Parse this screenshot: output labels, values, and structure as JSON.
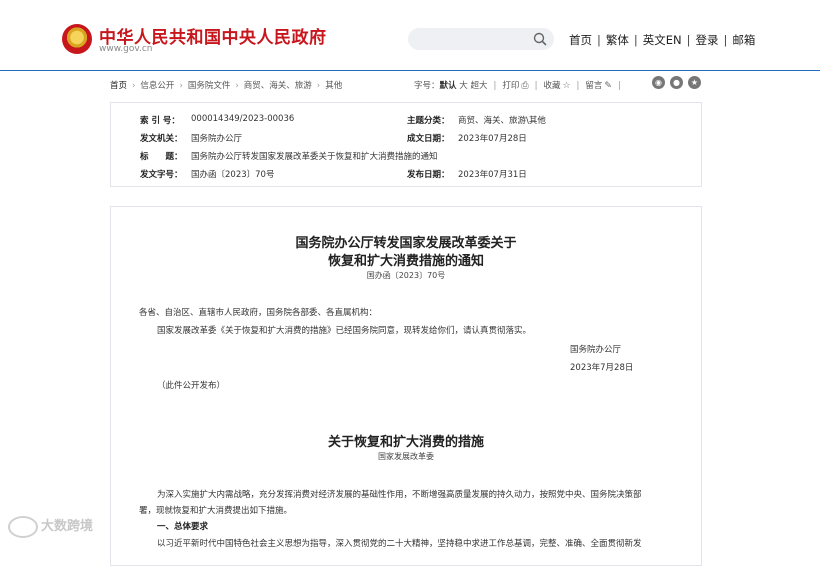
{
  "header": {
    "site_title": "中华人民共和国中央人民政府",
    "site_url": "www.gov.cn",
    "search": {
      "value": "",
      "placeholder": ""
    },
    "nav": [
      "首页",
      "繁体",
      "英文EN",
      "登录",
      "邮箱"
    ]
  },
  "breadcrumb": [
    "首页",
    "信息公开",
    "国务院文件",
    "商贸、海关、旅游",
    "其他"
  ],
  "toolbar": {
    "font_label": "字号：",
    "font_default": "默认",
    "font_large": "大",
    "font_xlarge": "超大",
    "print": "打印",
    "favorite": "收藏",
    "comment": "留言"
  },
  "metadata": {
    "index_label": "索 引 号：",
    "index_value": "000014349/2023-00036",
    "topic_label": "主题分类：",
    "topic_value": "商贸、海关、旅游\\其他",
    "issuer_label": "发文机关：",
    "issuer_value": "国务院办公厅",
    "created_label": "成文日期：",
    "created_value": "2023年07月28日",
    "title_label": "标　　题：",
    "title_value": "国务院办公厅转发国家发展改革委关于恢复和扩大消费措施的通知",
    "docno_label": "发文字号：",
    "docno_value": "国办函〔2023〕70号",
    "published_label": "发布日期：",
    "published_value": "2023年07月31日"
  },
  "article": {
    "title_line1": "国务院办公厅转发国家发展改革委关于",
    "title_line2": "恢复和扩大消费措施的通知",
    "doc_number": "国办函〔2023〕70号",
    "addressee": "各省、自治区、直辖市人民政府，国务院各部委、各直属机构：",
    "body_para": "国家发展改革委《关于恢复和扩大消费的措施》已经国务院同意，现转发给你们，请认真贯彻落实。",
    "signature": "国务院办公厅",
    "sign_date": "2023年7月28日",
    "publish_note": "（此件公开发布）",
    "section_title": "关于恢复和扩大消费的措施",
    "section_issuer": "国家发展改革委",
    "intro_line1": "为深入实施扩大内需战略，充分发挥消费对经济发展的基础性作用，不断增强高质量发展的持久动力，按照党中央、国务院决策部",
    "intro_line2": "署，现就恢复和扩大消费提出如下措施。",
    "heading_1": "一、总体要求",
    "next_line": "以习近平新时代中国特色社会主义思想为指导，深入贯彻党的二十大精神，坚持稳中求进工作总基调，完整、准确、全面贯彻新发"
  },
  "watermark": "大数跨境",
  "colors": {
    "brand_red": "#c8161d",
    "link_blue": "#1f6fbf"
  }
}
